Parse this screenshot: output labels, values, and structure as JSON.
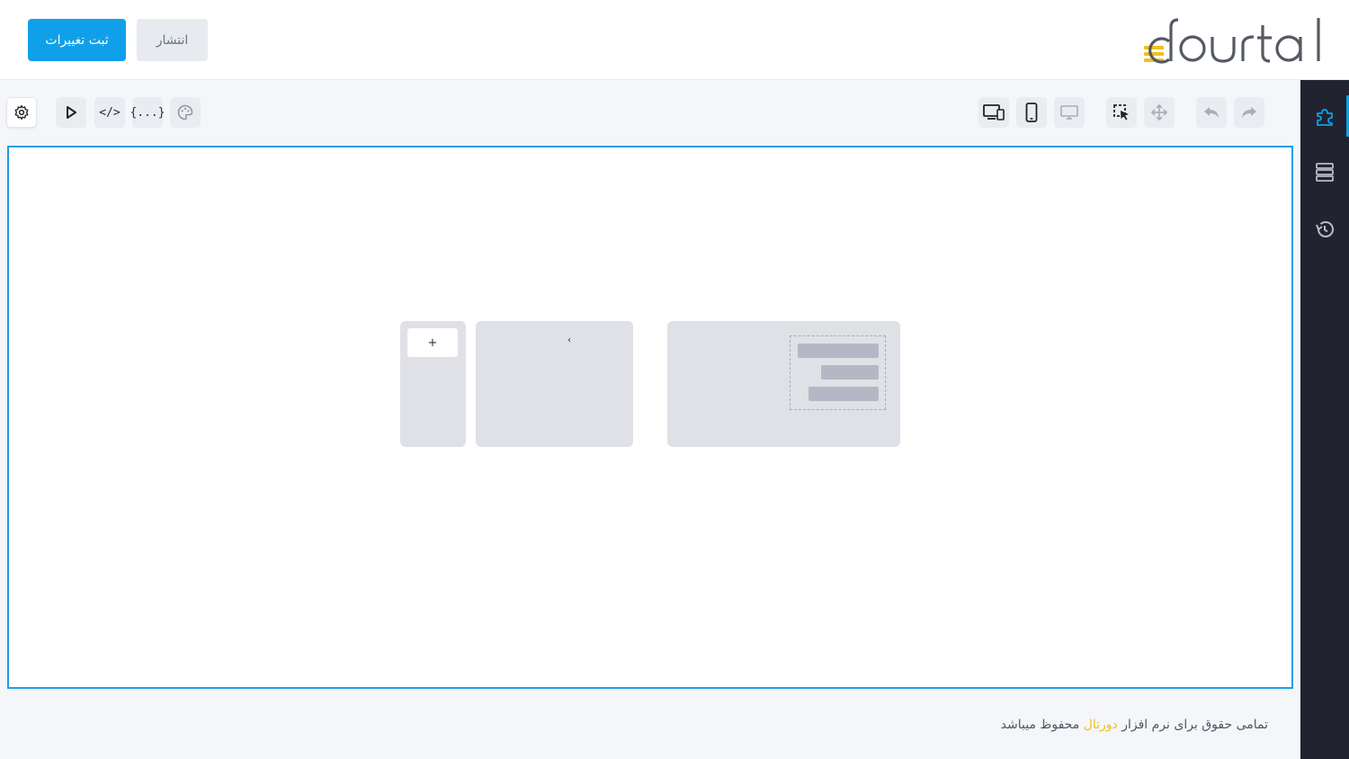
{
  "header": {
    "save_label": "ثبت تغییرات",
    "publish_label": "انتشار",
    "logo_text": "dourtal"
  },
  "toolbar": {
    "left": [
      "settings-icon",
      "play-icon",
      "code-icon",
      "json-icon",
      "style-icon"
    ],
    "code_label": "</>",
    "json_label": "{...}",
    "right": [
      "responsive-icon",
      "mobile-icon",
      "desktop-icon",
      "select-icon",
      "move-icon",
      "undo-icon",
      "redo-icon"
    ]
  },
  "sidebar": {
    "items": [
      "blocks-icon",
      "layers-icon",
      "history-icon"
    ],
    "active_color": "#10a0ea"
  },
  "canvas": {
    "move_glyph": "+",
    "small_glyph": "‹"
  },
  "footer": {
    "prefix": "تمامی حقوق برای نرم افزار ",
    "brand": "دورتال",
    "suffix": " محفوظ میباشد"
  },
  "colors": {
    "primary": "#10a0ea",
    "brand_yellow": "#f1bf1f",
    "sidebar_bg": "#212330",
    "canvas_border": "#1e9ee6"
  }
}
